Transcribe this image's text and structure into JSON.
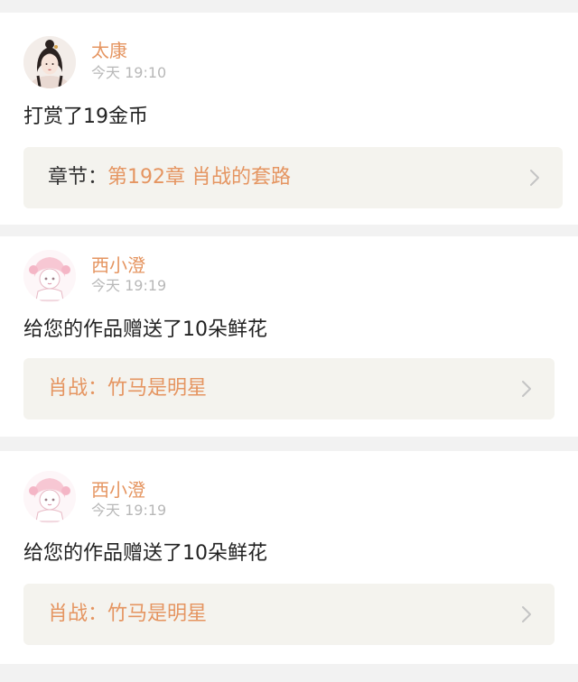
{
  "feed": {
    "items": [
      {
        "username": "太康",
        "time": "今天 19:10",
        "message": "打赏了19金币",
        "ref_prefix": "章节：",
        "ref_value": "第192章 肖战的套路"
      },
      {
        "username": "西小澄",
        "time": "今天 19:19",
        "message": "给您的作品赠送了10朵鲜花",
        "ref_prefix": "肖战：",
        "ref_value": "竹马是明星"
      },
      {
        "username": "西小澄",
        "time": "今天 19:19",
        "message": "给您的作品赠送了10朵鲜花",
        "ref_prefix": "肖战：",
        "ref_value": "竹马是明星"
      }
    ]
  },
  "colors": {
    "accent": "#e59561",
    "background": "#f2f2f2",
    "ref_box": "#f4f3ee",
    "timestamp": "#b8b8b8",
    "chevron": "#c4c4c4"
  },
  "icons": {
    "avatar_1": "avatar-icon",
    "avatar_2": "avatar-icon",
    "chevron": "chevron-right-icon"
  }
}
